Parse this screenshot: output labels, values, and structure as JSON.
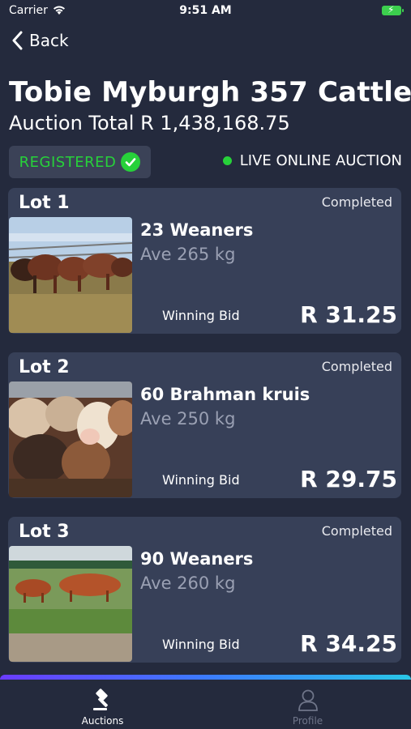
{
  "status": {
    "carrier": "Carrier",
    "time": "9:51 AM"
  },
  "nav": {
    "back_label": "Back"
  },
  "auction": {
    "title": "Tobie Myburgh 357 Cattle",
    "total_text": "Auction Total R 1,438,168.75",
    "registered_label": "REGISTERED",
    "live_label": "LIVE ONLINE AUCTION"
  },
  "lots": [
    {
      "label": "Lot 1",
      "status": "Completed",
      "name": "23 Weaners",
      "weight": "Ave 265 kg",
      "bid_label": "Winning Bid",
      "bid_value": "R 31.25"
    },
    {
      "label": "Lot 2",
      "status": "Completed",
      "name": "60 Brahman kruis",
      "weight": "Ave 250 kg",
      "bid_label": "Winning Bid",
      "bid_value": "R 29.75"
    },
    {
      "label": "Lot 3",
      "status": "Completed",
      "name": "90 Weaners",
      "weight": "Ave 260 kg",
      "bid_label": "Winning Bid",
      "bid_value": "R 34.25"
    }
  ],
  "tabs": [
    {
      "label": "Auctions",
      "icon": "gavel-icon",
      "active": true
    },
    {
      "label": "Profile",
      "icon": "person-icon",
      "active": false
    }
  ],
  "colors": {
    "background": "#242a3d",
    "card": "#374058",
    "accent_green": "#27d13a"
  }
}
